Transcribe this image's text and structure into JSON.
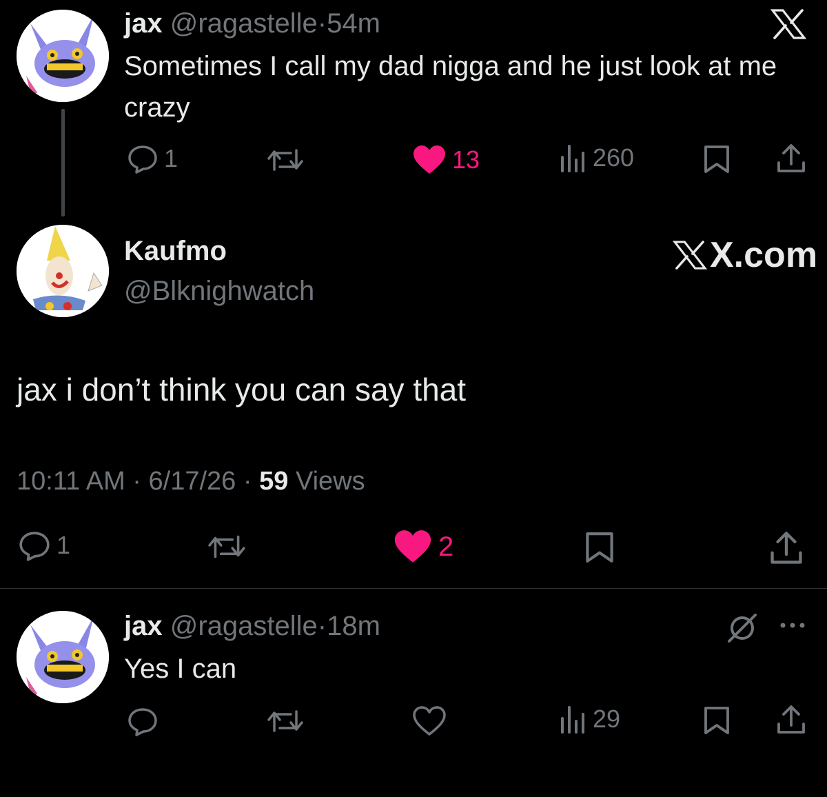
{
  "tweet1": {
    "name": "jax",
    "handle": "@ragastelle",
    "sep": "·",
    "time": "54m",
    "text": "Sometimes I call my dad nigga and he just look at me crazy",
    "replies": "1",
    "likes": "13",
    "views": "260"
  },
  "tweet2": {
    "name": "Kaufmo",
    "handle": "@Blknighwatch",
    "brand": "X.com",
    "text": "jax i don’t think you can say that",
    "time": "10:11 AM",
    "date": "6/17/26",
    "sep": "·",
    "views_count": "59",
    "views_label": "Views",
    "replies": "1",
    "likes": "2"
  },
  "tweet3": {
    "name": "jax",
    "handle": "@ragastelle",
    "sep": "·",
    "time": "18m",
    "text": "Yes I can",
    "views": "29"
  },
  "colors": {
    "background": "#000000",
    "text": "#e7e9ea",
    "muted": "#71767b",
    "like": "#f91880",
    "divider": "#2f3336"
  },
  "icons": [
    "x-logo-icon",
    "reply-icon",
    "retweet-icon",
    "heart-icon",
    "views-icon",
    "bookmark-icon",
    "share-icon",
    "circle-slash-icon",
    "more-icon"
  ]
}
